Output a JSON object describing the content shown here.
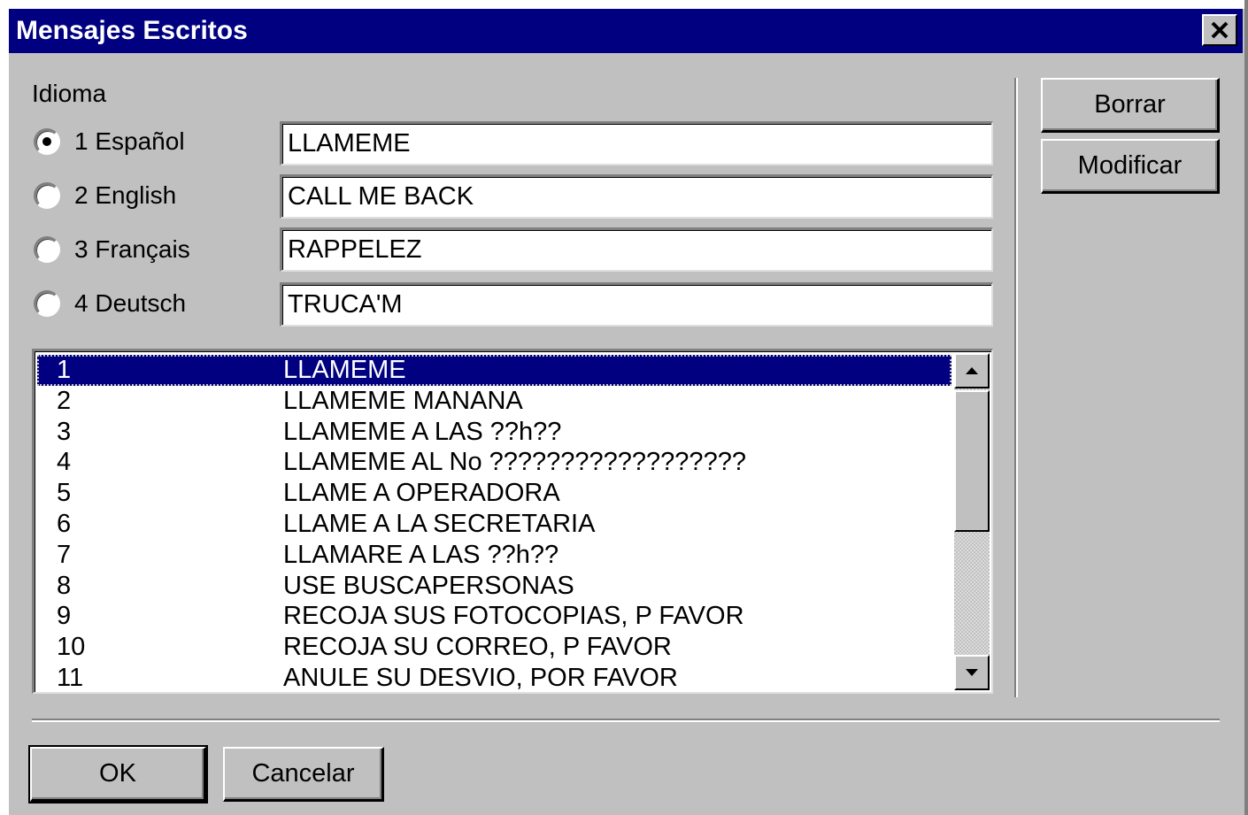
{
  "window": {
    "title": "Mensajes Escritos"
  },
  "language": {
    "group_label": "Idioma",
    "options": [
      {
        "label": "1 Español",
        "value": "LLAMEME",
        "selected": true
      },
      {
        "label": "2 English",
        "value": "CALL ME BACK",
        "selected": false
      },
      {
        "label": "3 Français",
        "value": "RAPPELEZ",
        "selected": false
      },
      {
        "label": "4 Deutsch",
        "value": "TRUCA'M",
        "selected": false
      }
    ]
  },
  "messages": [
    {
      "num": "1",
      "text": "LLAMEME",
      "selected": true
    },
    {
      "num": "2",
      "text": "LLAMEME MANANA"
    },
    {
      "num": "3",
      "text": "LLAMEME A LAS ??h??"
    },
    {
      "num": "4",
      "text": "LLAMEME AL No ??????????????????"
    },
    {
      "num": "5",
      "text": "LLAME A OPERADORA"
    },
    {
      "num": "6",
      "text": "LLAME A LA SECRETARIA"
    },
    {
      "num": "7",
      "text": "LLAMARE A LAS ??h??"
    },
    {
      "num": "8",
      "text": "USE BUSCAPERSONAS"
    },
    {
      "num": "9",
      "text": "RECOJA SUS FOTOCOPIAS, P FAVOR"
    },
    {
      "num": "10",
      "text": "RECOJA SU CORREO, P FAVOR"
    },
    {
      "num": "11",
      "text": "ANULE SU DESVIO, POR FAVOR"
    }
  ],
  "buttons": {
    "delete": "Borrar",
    "modify": "Modificar",
    "ok": "OK",
    "cancel": "Cancelar"
  }
}
